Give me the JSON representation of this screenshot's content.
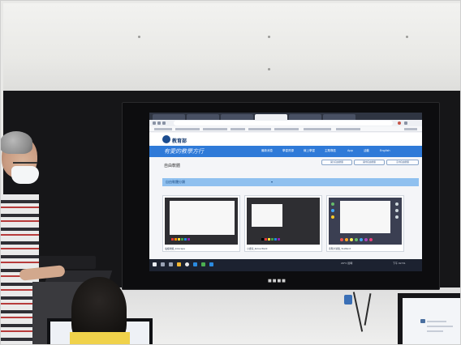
{
  "site": {
    "logo_text": "教育部",
    "tagline": "有愛的教學方行",
    "nav": [
      "最新消息",
      "學習資源",
      "線上學習",
      "主題專區",
      "App",
      "活動",
      "English"
    ],
    "page_title": "自由軟體",
    "buttons": [
      "國小自由軟體",
      "國中自由軟體",
      "高中自由軟體"
    ],
    "filter_label": "自由軟體分類",
    "cards": [
      {
        "label": "電繪軟體_Inkscape"
      },
      {
        "label": "小畫家_KolourPaint"
      },
      {
        "label": "塗鴉大冒險_TuxPaint"
      }
    ]
  },
  "taskbar": {
    "weather": "29°C 陰時",
    "clock": "下午 02:51"
  },
  "colors": {
    "nav_blue": "#2f7ad8",
    "filter_blue": "#8fc0ef",
    "tab_dark": "#2f3542",
    "taskbar": "#1c2230"
  },
  "icons": [
    "back-arrow-icon",
    "forward-arrow-icon",
    "reload-icon",
    "star-icon",
    "windows-start-icon",
    "search-icon",
    "chrome-icon",
    "folder-icon"
  ]
}
